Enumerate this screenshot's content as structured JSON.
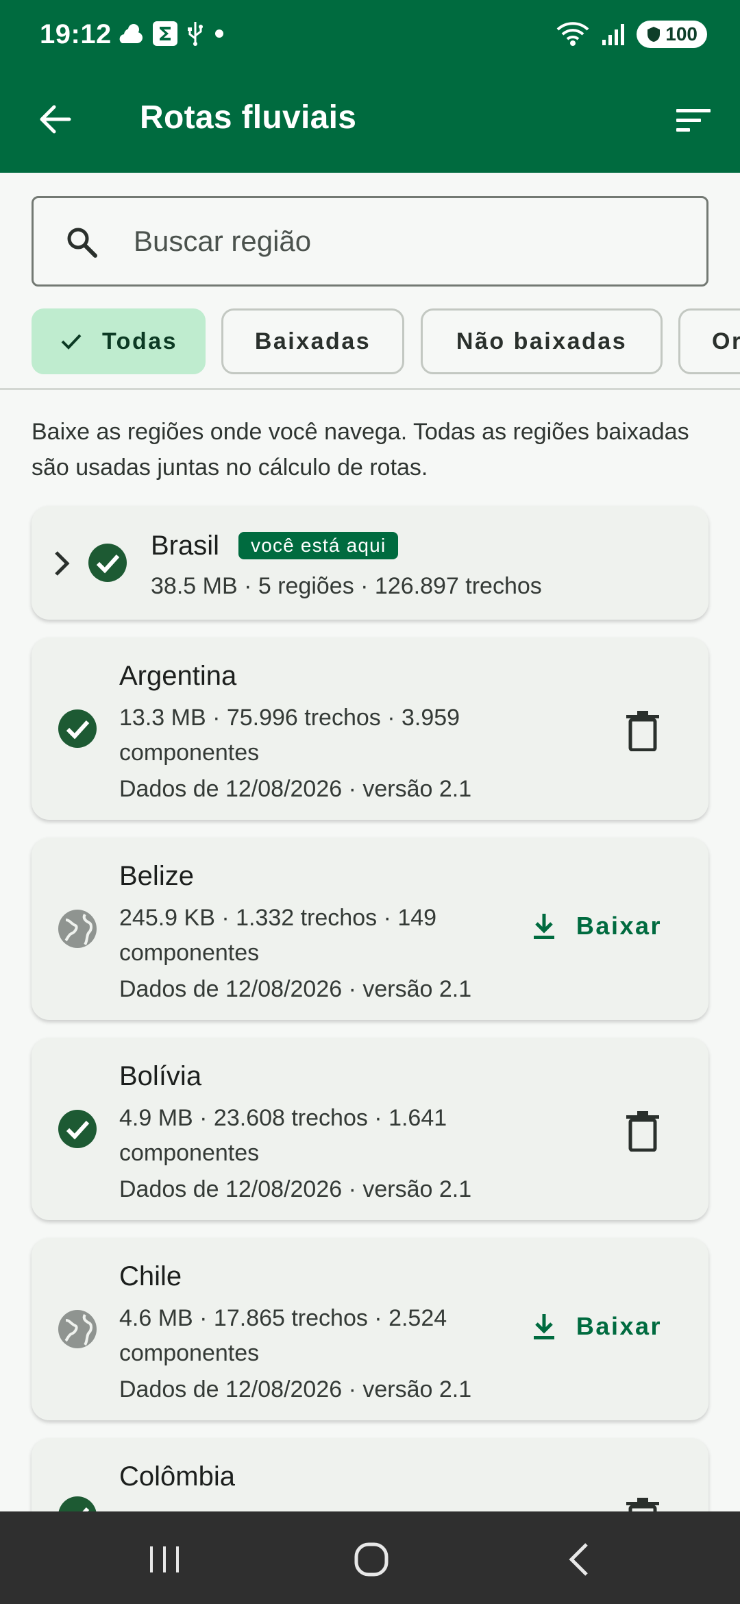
{
  "status_bar": {
    "time": "19:12",
    "battery": "100",
    "icons": [
      "weather-cloud-icon",
      "sigma-app-icon",
      "usb-icon",
      "dot-icon",
      "wifi-icon",
      "signal-icon",
      "battery-shield-icon"
    ]
  },
  "app_bar": {
    "title": "Rotas fluviais",
    "back_icon": "arrow-left-icon",
    "sort_icon": "sort-icon"
  },
  "search": {
    "placeholder": "Buscar região",
    "value": ""
  },
  "filters": [
    {
      "label": "Todas",
      "selected": true
    },
    {
      "label": "Baixadas",
      "selected": false
    },
    {
      "label": "Não baixadas",
      "selected": false
    },
    {
      "label": "Or",
      "selected": false
    }
  ],
  "intro_text": "Baixe as regiões onde você navega. Todas as regiões baixadas são usadas juntas no cálculo de rotas.",
  "group": {
    "name": "Brasil",
    "badge": "você está aqui",
    "meta": "38.5 MB · 5 regiões · 126.897 trechos"
  },
  "regions": [
    {
      "name": "Argentina",
      "meta": "13.3 MB · 75.996 trechos · 3.959 componentes",
      "date": "Dados de 12/08/2026 · versão 2.1",
      "status": "downloaded"
    },
    {
      "name": "Belize",
      "meta": "245.9 KB · 1.332 trechos · 149 componentes",
      "date": "Dados de 12/08/2026 · versão 2.1",
      "status": "not_downloaded",
      "action_label": "Baixar"
    },
    {
      "name": "Bolívia",
      "meta": "4.9 MB · 23.608 trechos · 1.641 componentes",
      "date": "Dados de 12/08/2026 · versão 2.1",
      "status": "downloaded"
    },
    {
      "name": "Chile",
      "meta": "4.6 MB · 17.865 trechos · 2.524 componentes",
      "date": "Dados de 12/08/2026 · versão 2.1",
      "status": "not_downloaded",
      "action_label": "Baixar"
    },
    {
      "name": "Colômbia",
      "meta": "",
      "date": "",
      "status": "downloaded"
    }
  ],
  "colors": {
    "primary": "#006b3f",
    "chip_selected": "#bfeccf",
    "card_bg": "#eff2ee",
    "ok_icon": "#1d5a33",
    "globe_icon": "#8f9490"
  }
}
